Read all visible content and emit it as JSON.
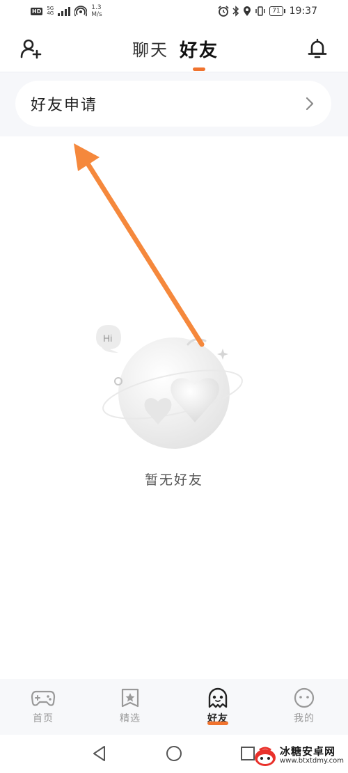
{
  "status_bar": {
    "hd": "HD",
    "network_top": "5G",
    "network_bottom": "4G",
    "speed_value": "1.3",
    "speed_unit": "M/s",
    "battery": "71",
    "time": "19:37"
  },
  "header": {
    "tabs": [
      {
        "label": "聊天",
        "active": false
      },
      {
        "label": "好友",
        "active": true
      }
    ]
  },
  "friend_request": {
    "label": "好友申请"
  },
  "empty_state": {
    "bubble_text": "Hi",
    "message": "暂无好友"
  },
  "bottom_nav": {
    "items": [
      {
        "label": "首页",
        "icon": "gamepad-icon",
        "active": false
      },
      {
        "label": "精选",
        "icon": "star-bookmark-icon",
        "active": false
      },
      {
        "label": "好友",
        "icon": "ghost-icon",
        "active": true
      },
      {
        "label": "我的",
        "icon": "face-icon",
        "active": false
      }
    ]
  },
  "watermark": {
    "name": "冰糖安卓网",
    "url": "www.btxtdmy.com"
  },
  "colors": {
    "accent": "#f0732e",
    "arrow": "#f5883c"
  }
}
